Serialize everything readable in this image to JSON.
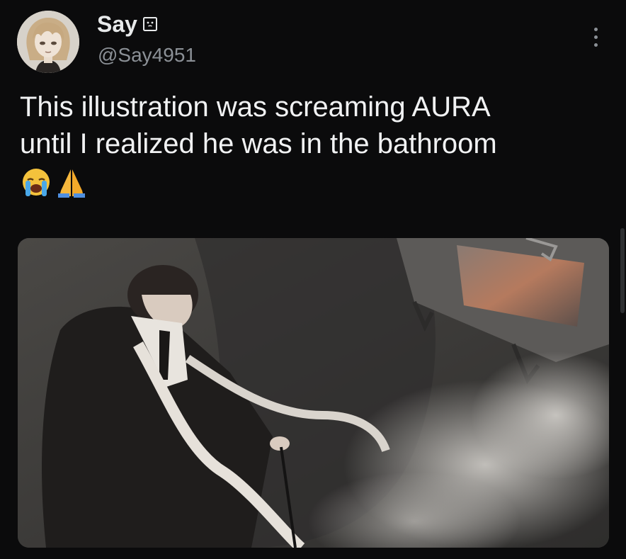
{
  "post": {
    "author": {
      "display_name": "Say",
      "badge_icon": "face-card-icon",
      "handle": "@Say4951",
      "avatar_icon": "blonde-character-avatar"
    },
    "more_icon": "more-vertical-icon",
    "text_lines": [
      "This illustration was screaming AURA",
      "until I realized he was in the bathroom"
    ],
    "emojis": [
      "😭",
      "🙏"
    ],
    "media": {
      "kind": "illustration",
      "icon": "anime-illustration-image"
    }
  },
  "colors": {
    "background": "#0b0b0c",
    "primary_text": "#e7e9ea",
    "secondary_text": "#8b9096"
  }
}
